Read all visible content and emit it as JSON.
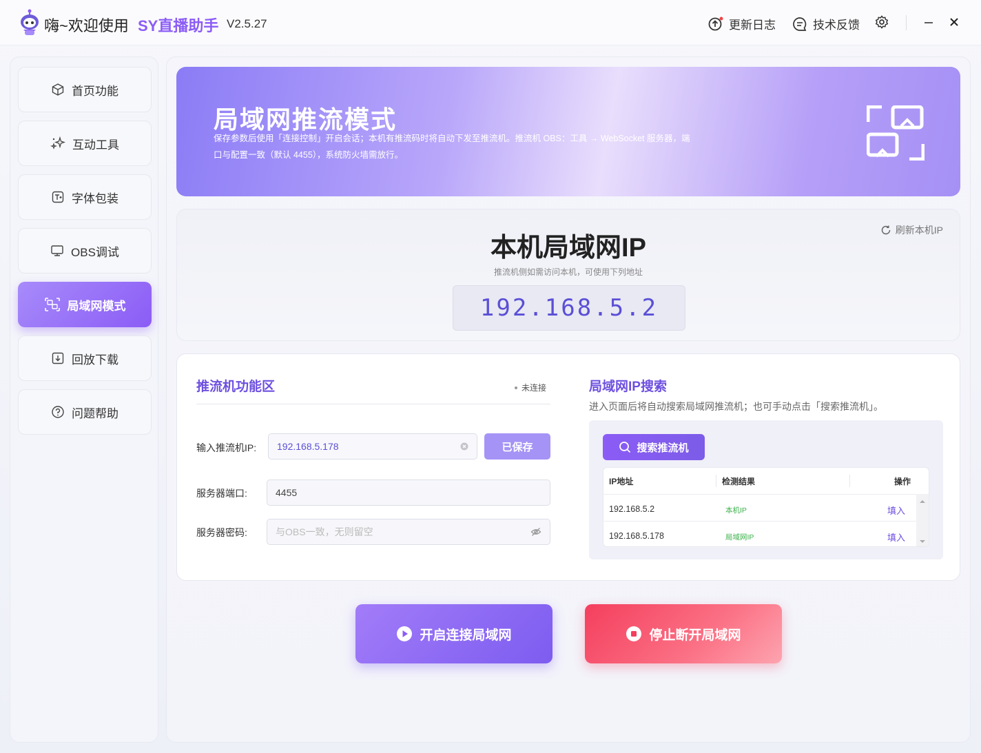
{
  "titlebar": {
    "greeting": "嗨~欢迎使用",
    "brand": "SY直播助手",
    "version": "V2.5.27",
    "changelog": "更新日志",
    "feedback": "技术反馈"
  },
  "sidebar": {
    "items": [
      {
        "label": "首页功能",
        "icon": "cube-icon"
      },
      {
        "label": "互动工具",
        "icon": "sparkle-icon"
      },
      {
        "label": "字体包装",
        "icon": "text-icon"
      },
      {
        "label": "OBS调试",
        "icon": "monitor-icon"
      },
      {
        "label": "局域网模式",
        "icon": "lan-icon",
        "active": true
      },
      {
        "label": "回放下载",
        "icon": "download-icon"
      },
      {
        "label": "问题帮助",
        "icon": "help-icon"
      }
    ]
  },
  "banner": {
    "title": "局域网推流模式",
    "desc": "保存参数后使用「连接控制」开启会话；本机有推流码时将自动下发至推流机。推流机 OBS：工具 → WebSocket 服务器，端口与配置一致（默认 4455），系统防火墙需放行。"
  },
  "ip_card": {
    "title": "本机局域网IP",
    "subtitle": "推流机侧如需访问本机，可使用下列地址",
    "ip": "192.168.5.2",
    "refresh": "刷新本机IP"
  },
  "pusher": {
    "title": "推流机功能区",
    "status": "未连接",
    "ip_label": "输入推流机IP:",
    "ip_value": "192.168.5.178",
    "save_label": "已保存",
    "port_label": "服务器端口:",
    "port_value": "4455",
    "password_label": "服务器密码:",
    "password_placeholder": "与OBS一致，无则留空"
  },
  "search": {
    "title": "局域网IP搜索",
    "desc": "进入页面后将自动搜索局域网推流机；也可手动点击「搜索推流机」。",
    "button": "搜索推流机",
    "columns": [
      "IP地址",
      "检测结果",
      "操作"
    ],
    "rows": [
      {
        "ip": "192.168.5.2",
        "result": "本机IP",
        "action": "填入"
      },
      {
        "ip": "192.168.5.178",
        "result": "局域网IP",
        "action": "填入"
      }
    ]
  },
  "actions": {
    "start": "开启连接局域网",
    "stop": "停止断开局域网"
  },
  "colors": {
    "accent": "#8b5cf6",
    "stop": "#f43f5e",
    "ok": "#3bb14a"
  }
}
